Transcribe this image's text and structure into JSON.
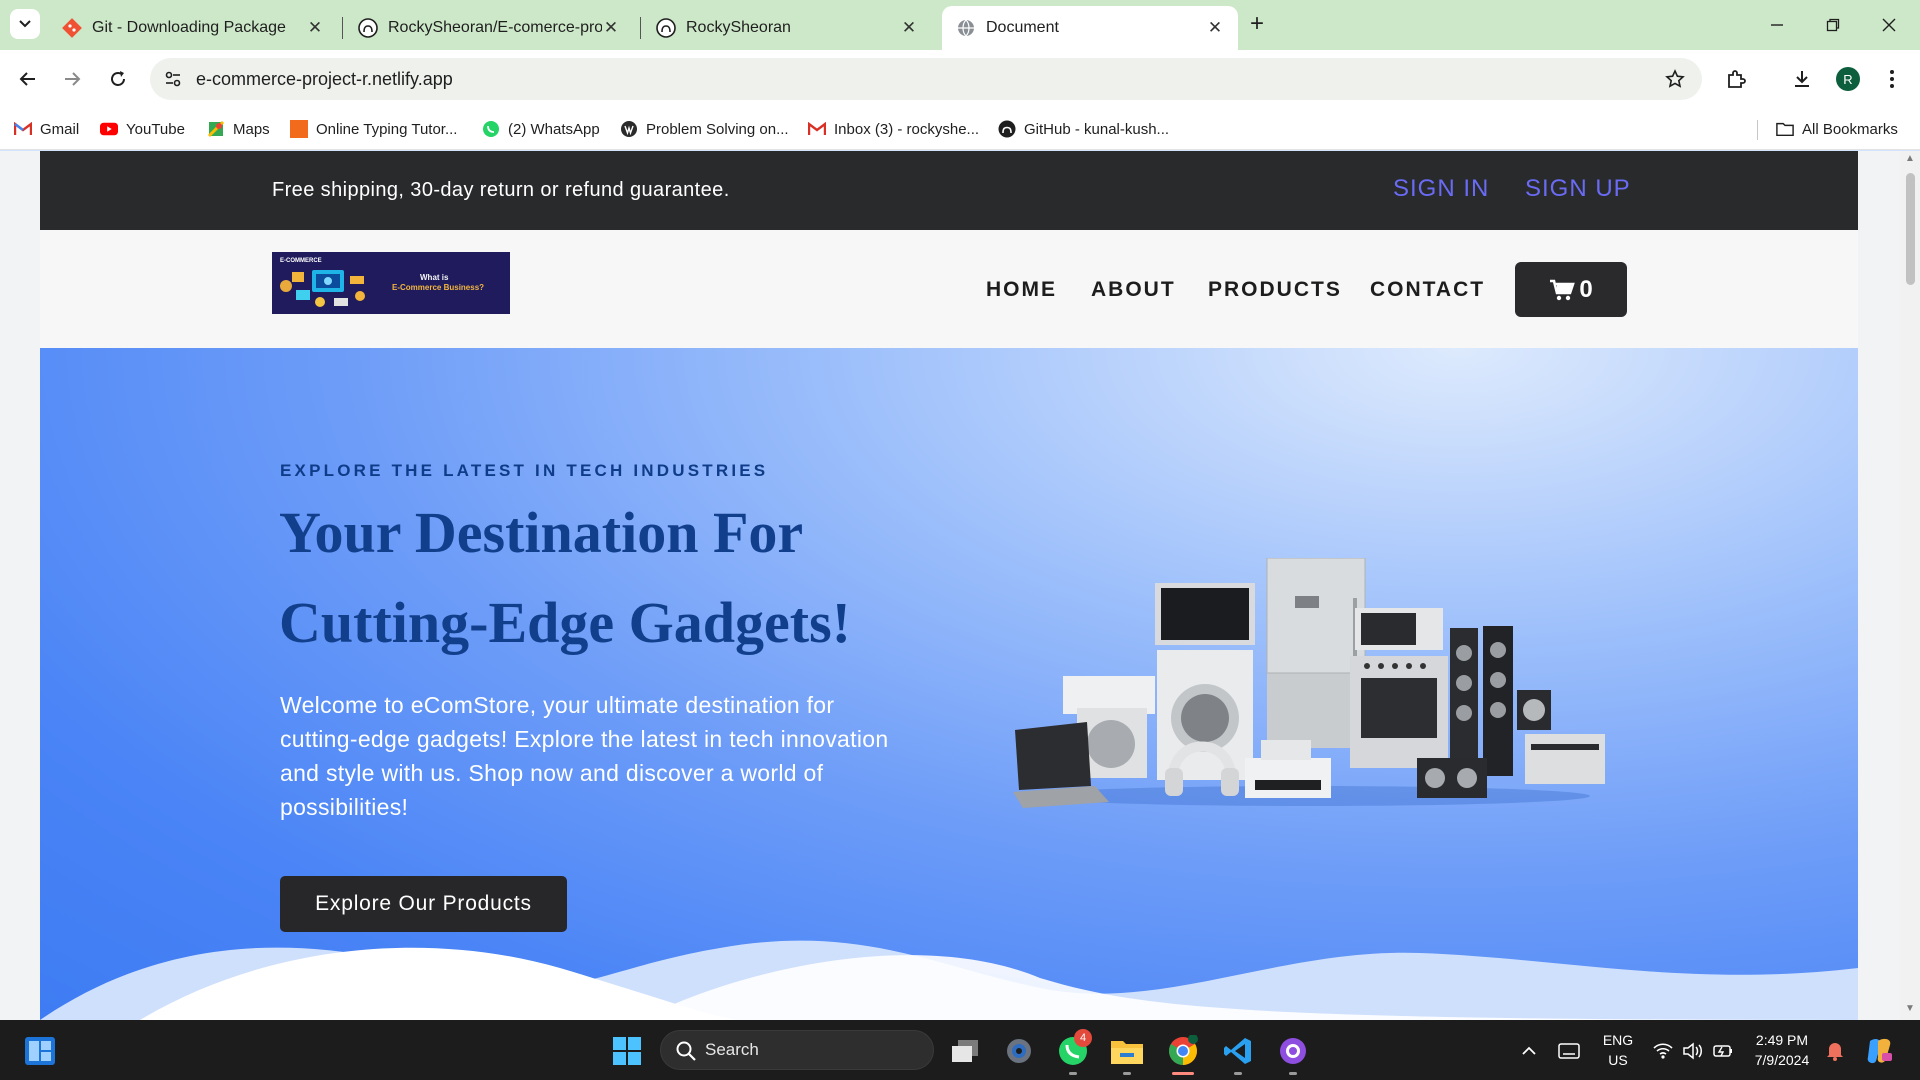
{
  "browser": {
    "tabs": [
      {
        "title": "Git - Downloading Package",
        "icon": "git-icon"
      },
      {
        "title": "RockySheoran/E-comerce-proje",
        "icon": "github-icon"
      },
      {
        "title": "RockySheoran",
        "icon": "github-icon"
      },
      {
        "title": "Document",
        "icon": "globe-icon",
        "active": true
      }
    ],
    "url": "e-commerce-project-r.netlify.app",
    "profile_initial": "R",
    "bookmarks": [
      {
        "label": "Gmail",
        "icon": "gmail-icon"
      },
      {
        "label": "YouTube",
        "icon": "youtube-icon"
      },
      {
        "label": "Maps",
        "icon": "maps-icon"
      },
      {
        "label": "Online Typing Tutor...",
        "icon": "typing-icon"
      },
      {
        "label": "(2) WhatsApp",
        "icon": "whatsapp-icon"
      },
      {
        "label": "Problem Solving on...",
        "icon": "wordpress-icon"
      },
      {
        "label": "Inbox (3) - rockyshe...",
        "icon": "gmail-icon"
      },
      {
        "label": "GitHub - kunal-kush...",
        "icon": "github-icon"
      }
    ],
    "all_bookmarks_label": "All Bookmarks"
  },
  "site": {
    "topbar": {
      "message": "Free shipping, 30-day return or refund guarantee.",
      "sign_in": "SIGN IN",
      "sign_up": "SIGN UP"
    },
    "logo": {
      "kicker": "E-COMMERCE",
      "line1": "What is",
      "line2": "E-Commerce Business?"
    },
    "nav": {
      "home": "HOME",
      "about": "ABOUT",
      "products": "PRODUCTS",
      "contact": "CONTACT",
      "cart_count": "0"
    },
    "hero": {
      "kicker": "EXPLORE THE LATEST IN TECH INDUSTRIES",
      "title": "Your Destination For Cutting-Edge Gadgets!",
      "description": "Welcome to eComStore, your ultimate destination for cutting-edge gadgets! Explore the latest in tech innovation and style with us. Shop now and discover a world of possibilities!",
      "cta": "Explore Our Products"
    }
  },
  "taskbar": {
    "search_placeholder": "Search",
    "whatsapp_badge": "4",
    "language": "ENG",
    "region": "US",
    "time": "2:49 PM",
    "date": "7/9/2024"
  },
  "colors": {
    "topbar_bg": "#292a2c",
    "link_accent": "#6a6bf5",
    "hero_title": "#123f8c",
    "hero_blue": "#4a84f6",
    "tab_strip": "#cde8c8"
  }
}
